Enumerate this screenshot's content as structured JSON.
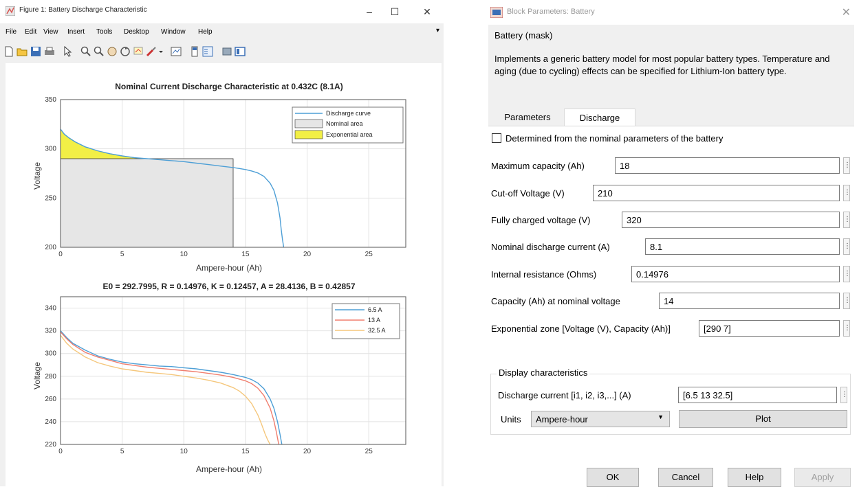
{
  "figure_window": {
    "title": "Figure 1: Battery Discharge Characteristic",
    "menu": [
      "File",
      "Edit",
      "View",
      "Insert",
      "Tools",
      "Desktop",
      "Window",
      "Help"
    ],
    "window_controls": {
      "minimize": "–",
      "maximize": "☐",
      "close": "✕"
    },
    "menu_overflow": "▾"
  },
  "chart_data": [
    {
      "type": "area",
      "title": "Nominal Current Discharge Characteristic at 0.432C (8.1A)",
      "xlabel": "Ampere-hour (Ah)",
      "ylabel": "Voltage",
      "xlim": [
        0,
        28
      ],
      "ylim": [
        200,
        350
      ],
      "xticks": [
        0,
        5,
        10,
        15,
        20,
        25
      ],
      "yticks": [
        200,
        250,
        300,
        350
      ],
      "grid": true,
      "legend_position": "top-right",
      "legend": [
        "Discharge curve",
        "Nominal area",
        "Exponential area"
      ],
      "series": [
        {
          "name": "Discharge curve",
          "color": "#4d9fd6",
          "x": [
            0,
            0.3,
            0.7,
            1.2,
            2,
            3,
            4,
            5,
            6,
            7,
            8,
            9,
            10,
            11,
            12,
            13,
            14,
            14.5,
            15,
            15.5,
            16,
            16.5,
            17,
            17.3,
            17.6,
            17.8,
            17.9,
            18,
            18.1
          ],
          "y": [
            320,
            315,
            311,
            307,
            302,
            298,
            295,
            292.8,
            291,
            290,
            289,
            288,
            287,
            285.5,
            284,
            282.5,
            281,
            280,
            279,
            277.5,
            275.5,
            272,
            265,
            258,
            245,
            230,
            218,
            208,
            200
          ]
        }
      ],
      "nominal_area": {
        "color": "#e6e6e6",
        "x_end": 14,
        "voltage": 290
      },
      "exponential_area": {
        "color": "#f2ef46",
        "x_end": 7,
        "voltage_start": 320,
        "voltage_end": 290
      }
    },
    {
      "type": "line",
      "title": "E0 = 292.7995, R = 0.14976, K = 0.12457, A = 28.4136, B = 0.42857",
      "xlabel": "Ampere-hour (Ah)",
      "ylabel": "Voltage",
      "xlim": [
        0,
        28
      ],
      "ylim": [
        220,
        350
      ],
      "xticks": [
        0,
        5,
        10,
        15,
        20,
        25
      ],
      "yticks": [
        220,
        240,
        260,
        280,
        300,
        320,
        340
      ],
      "grid": true,
      "legend_position": "top-right",
      "series": [
        {
          "name": "6.5 A",
          "color": "#4d9fd6",
          "x": [
            0,
            0.5,
            1,
            2,
            3,
            4,
            5,
            6,
            7,
            8,
            9,
            10,
            11,
            12,
            13,
            14,
            15,
            15.5,
            16,
            16.5,
            17,
            17.3,
            17.6,
            17.8,
            17.95
          ],
          "y": [
            320,
            314,
            309,
            303,
            298,
            295,
            292.5,
            291,
            290,
            289,
            288.5,
            287.5,
            286.5,
            285,
            283.5,
            281.5,
            279,
            277,
            274,
            269,
            260,
            252,
            240,
            229,
            220
          ]
        },
        {
          "name": "13 A",
          "color": "#f07e6e",
          "x": [
            0,
            0.5,
            1,
            2,
            3,
            4,
            5,
            6,
            7,
            8,
            9,
            10,
            11,
            12,
            13,
            14,
            15,
            15.5,
            16,
            16.5,
            17,
            17.3,
            17.5,
            17.7
          ],
          "y": [
            319,
            313,
            308,
            301,
            297,
            294,
            291,
            289.5,
            288,
            287,
            286,
            285,
            284,
            282.5,
            281,
            279,
            276,
            273.5,
            269.5,
            263,
            252,
            241,
            231,
            220
          ]
        },
        {
          "name": "32.5 A",
          "color": "#f5c77c",
          "x": [
            0,
            0.5,
            1,
            2,
            3,
            4,
            5,
            6,
            7,
            8,
            9,
            10,
            11,
            12,
            13,
            14,
            14.5,
            15,
            15.5,
            16,
            16.3,
            16.6,
            16.8,
            17
          ],
          "y": [
            316,
            309,
            304,
            297,
            292,
            289,
            286.5,
            285,
            283.5,
            282.5,
            281.5,
            280,
            278.5,
            276.5,
            274,
            270,
            267,
            262.5,
            256,
            246,
            238,
            229,
            224,
            220
          ]
        }
      ]
    }
  ],
  "dialog": {
    "title": "Block Parameters: Battery",
    "close": "✕",
    "mask_title": "Battery (mask)",
    "mask_description": "Implements a generic battery model for most popular battery types. Temperature and aging (due to cycling) effects can be specified for Lithium-Ion battery type.",
    "tabs": [
      "Parameters",
      "Discharge"
    ],
    "checkbox_label": "Determined from the nominal parameters of the battery",
    "fields": [
      {
        "label": "Maximum capacity (Ah)",
        "value": "18"
      },
      {
        "label": "Cut-off Voltage (V)",
        "value": "210"
      },
      {
        "label": "Fully charged voltage (V)",
        "value": "320"
      },
      {
        "label": "Nominal discharge current (A)",
        "value": "8.1"
      },
      {
        "label": "Internal resistance (Ohms)",
        "value": "0.14976"
      },
      {
        "label": "Capacity (Ah) at nominal voltage",
        "value": "14"
      },
      {
        "label": "Exponential zone [Voltage (V), Capacity (Ah)]",
        "value": "[290  7]"
      }
    ],
    "display_group": {
      "title": "Display characteristics",
      "discharge_current_label": "Discharge current [i1, i2, i3,...] (A)",
      "discharge_current_value": "[6.5 13 32.5]",
      "units_label": "Units",
      "units_value": "Ampere-hour",
      "plot_label": "Plot"
    },
    "buttons": {
      "ok": "OK",
      "cancel": "Cancel",
      "help": "Help",
      "apply": "Apply"
    },
    "more_button": "⋮"
  }
}
